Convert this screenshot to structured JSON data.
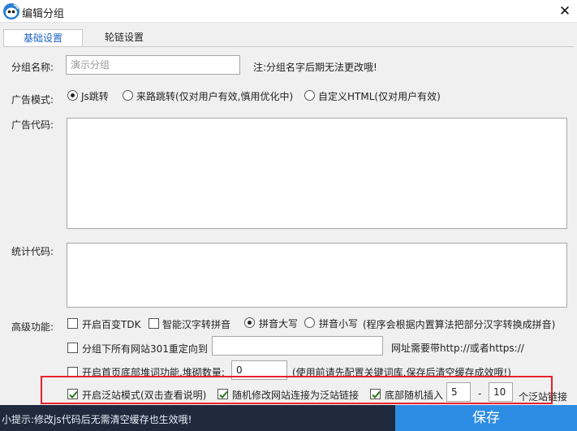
{
  "window": {
    "title": "编辑分组",
    "close_glyph": "✕",
    "icon": "app-logo-icon"
  },
  "tabs": [
    {
      "label": "基础设置",
      "active": true
    },
    {
      "label": "轮链设置",
      "active": false
    }
  ],
  "group_name": {
    "label": "分组名称:",
    "placeholder": "演示分组",
    "value": "",
    "note": "注:分组名字后期无法更改哦!"
  },
  "ad_mode": {
    "label": "广告模式:",
    "options": [
      {
        "label": "Js跳转",
        "selected": true
      },
      {
        "label": "来路跳转(仅对用户有效,慎用优化中)",
        "selected": false
      },
      {
        "label": "自定义HTML(仅对用户有效)",
        "selected": false
      }
    ]
  },
  "ad_code": {
    "label": "广告代码:",
    "value": ""
  },
  "stats_code": {
    "label": "统计代码:",
    "value": ""
  },
  "advanced": {
    "label": "高级功能:",
    "row1": {
      "baidu_tdk": {
        "label": "开启百变TDK",
        "checked": false
      },
      "smart_pinyin": {
        "label": "智能汉字转拼音",
        "checked": false
      },
      "pinyin_upper": {
        "label": "拼音大写",
        "selected": true
      },
      "pinyin_lower": {
        "label": "拼音小写",
        "selected": false
      },
      "note": "(程序会根据内置算法把部分汉字转换成拼音)"
    },
    "row2": {
      "redirect301": {
        "label": "分组下所有网站301重定向到",
        "checked": false
      },
      "url_value": "",
      "note": "网址需要带http://或者https://"
    },
    "row3": {
      "footer_keywords": {
        "label": "开启首页底部堆词功能,堆砌数量:",
        "checked": false
      },
      "count_value": "0",
      "note": "(使用前请先配置关键词库,保存后清空缓存成效哦!)"
    },
    "row4": {
      "pan_site": {
        "label": "开启泛站模式(双击查看说明)",
        "checked": true
      },
      "random_link": {
        "label": "随机修改网站连接为泛站链接",
        "checked": true
      },
      "footer_random": {
        "label": "底部随机插入",
        "checked": true
      },
      "min_value": "5",
      "dash": "-",
      "max_value": "10",
      "suffix": "个泛站链接"
    }
  },
  "status": {
    "tip": "小提示:修改js代码后无需清空缓存也生效哦!"
  },
  "save": {
    "label": "保存"
  },
  "colors": {
    "accent": "#2d8ce3",
    "statusbar": "#1f2a3f",
    "highlight": "#e8212a",
    "checkmark": "#2a7a1f"
  }
}
